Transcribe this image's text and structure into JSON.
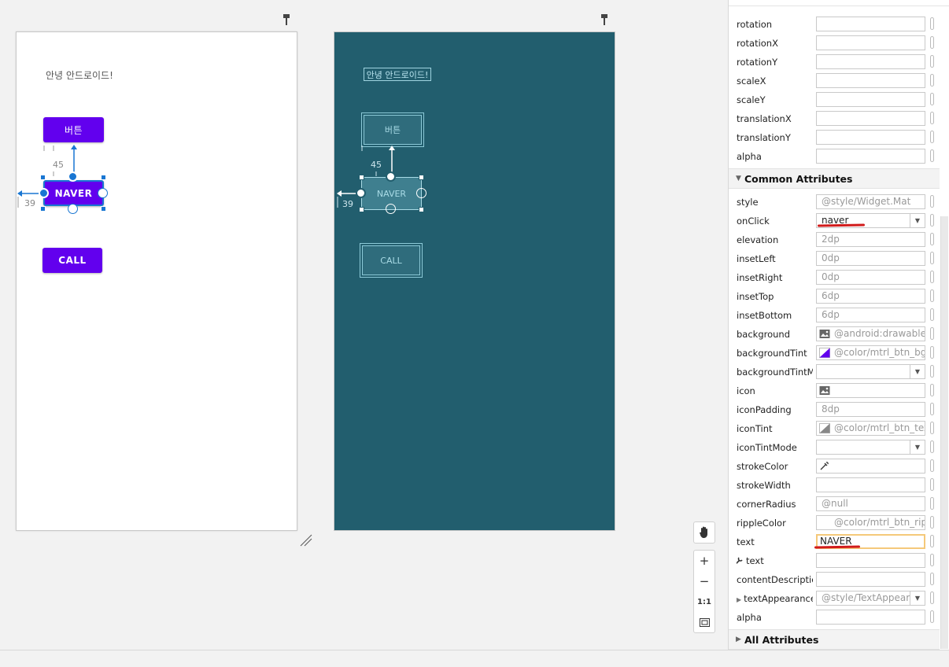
{
  "design_view": {
    "hello_text": "안녕 안드로이드!",
    "button_1": "버튼",
    "button_naver": "NAVER",
    "button_call": "CALL",
    "margin_top": "45",
    "margin_left": "39"
  },
  "blueprint_view": {
    "hello_text": "안녕 안드로이드!",
    "button_1": "버튼",
    "button_naver": "NAVER",
    "button_call": "CALL",
    "margin_top": "45",
    "margin_left": "39"
  },
  "zoom_tools": {
    "pan_icon": "hand-icon",
    "zoom_in": "+",
    "zoom_out": "−",
    "actual_size": "1:1",
    "fit_icon": "fit-screen-icon"
  },
  "attributes": {
    "transform_rows": [
      {
        "label": "rotation",
        "value": ""
      },
      {
        "label": "rotationX",
        "value": ""
      },
      {
        "label": "rotationY",
        "value": ""
      },
      {
        "label": "scaleX",
        "value": ""
      },
      {
        "label": "scaleY",
        "value": ""
      },
      {
        "label": "translationX",
        "value": ""
      },
      {
        "label": "translationY",
        "value": ""
      },
      {
        "label": "alpha",
        "value": ""
      }
    ],
    "common_title": "Common Attributes",
    "common_rows": [
      {
        "label": "style",
        "value": "@style/Widget.Mat"
      },
      {
        "label": "onClick",
        "value": "naver"
      },
      {
        "label": "elevation",
        "value": "2dp"
      },
      {
        "label": "insetLeft",
        "value": "0dp"
      },
      {
        "label": "insetRight",
        "value": "0dp"
      },
      {
        "label": "insetTop",
        "value": "6dp"
      },
      {
        "label": "insetBottom",
        "value": "6dp"
      },
      {
        "label": "background",
        "value": "@android:drawable/b"
      },
      {
        "label": "backgroundTint",
        "value": "@color/mtrl_btn_bg_c"
      },
      {
        "label": "backgroundTintM...",
        "value": ""
      },
      {
        "label": "icon",
        "value": ""
      },
      {
        "label": "iconPadding",
        "value": "8dp"
      },
      {
        "label": "iconTint",
        "value": "@color/mtrl_btn_text_"
      },
      {
        "label": "iconTintMode",
        "value": ""
      },
      {
        "label": "strokeColor",
        "value": ""
      },
      {
        "label": "strokeWidth",
        "value": ""
      },
      {
        "label": "cornerRadius",
        "value": "@null"
      },
      {
        "label": "rippleColor",
        "value": "@color/mtrl_btn_ripp"
      },
      {
        "label": "text",
        "value": "NAVER"
      },
      {
        "label": "text",
        "value": ""
      },
      {
        "label": "contentDescription",
        "value": ""
      },
      {
        "label": "textAppearance",
        "value": "@style/TextAppeara"
      },
      {
        "label": "alpha",
        "value": ""
      }
    ],
    "all_title": "All Attributes"
  },
  "colors": {
    "primary_button": "#6200ee",
    "blueprint_bg": "#225e6e",
    "selection": "#1976d2",
    "annotation_red": "#d11b1b",
    "focus_border": "#f5c97a"
  }
}
